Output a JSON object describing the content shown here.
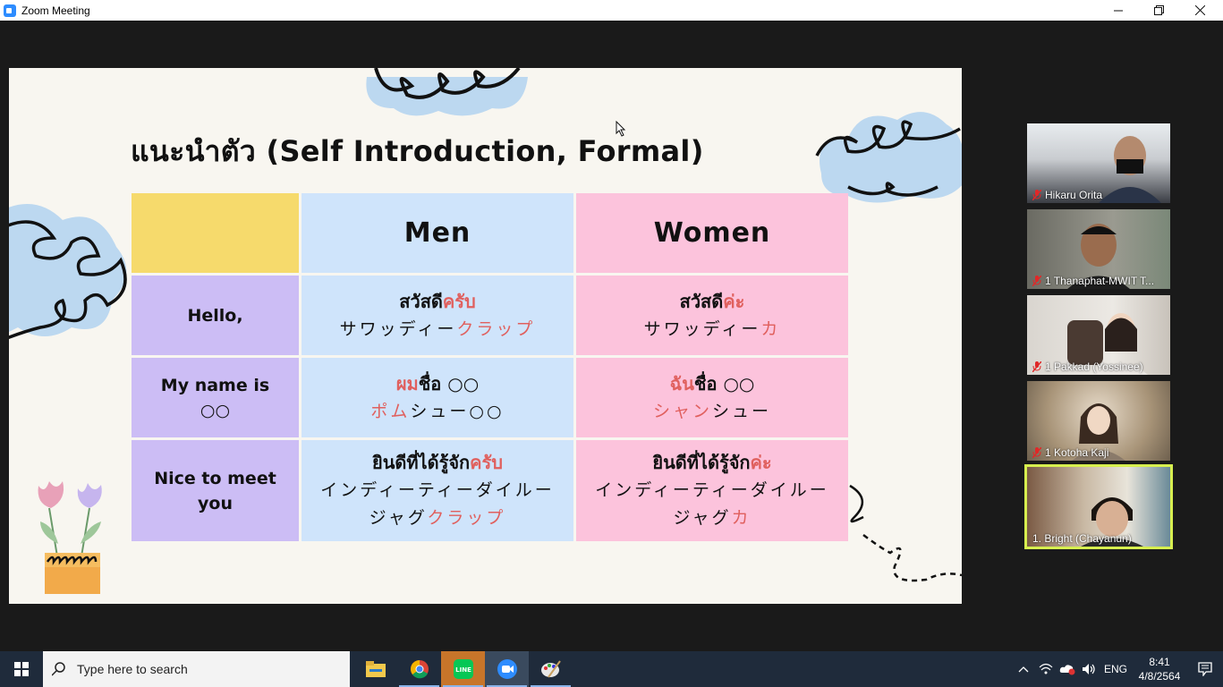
{
  "window": {
    "title": "Zoom Meeting",
    "minimize_icon": "minimize-icon",
    "restore_icon": "restore-icon",
    "close_icon": "close-icon"
  },
  "slide": {
    "title": "แนะนำตัว (Self Introduction, Formal)",
    "header": {
      "corner": "",
      "men": "Men",
      "women": "Women"
    },
    "rows": [
      {
        "label": "Hello,",
        "men_thai_a": "สวัสดี",
        "men_thai_b": "ครับ",
        "men_jp_a": "サワッディー",
        "men_jp_b": "クラップ",
        "women_thai_a": "สวัสดี",
        "women_thai_b": "ค่ะ",
        "women_jp_a": "サワッディー",
        "women_jp_b": "カ"
      },
      {
        "label_a": "My name is",
        "label_b": "○○",
        "men_thai_a": "ผม",
        "men_thai_b": "ชื่อ ○○",
        "men_jp_a": "ポム",
        "men_jp_b": "シュー○○",
        "women_thai_a": "ฉัน",
        "women_thai_b": "ชื่อ ○○",
        "women_jp_a": "シャン",
        "women_jp_b": "シュー"
      },
      {
        "label_a": "Nice to meet",
        "label_b": "you",
        "men_thai_a": "ยินดีที่ได้รู้จัก",
        "men_thai_b": "ครับ",
        "men_jp_a": "インディーティーダイルー",
        "men_jp_b": "ジャグ",
        "men_jp_c": "クラップ",
        "women_thai_a": "ยินดีที่ได้รู้จัก",
        "women_thai_b": "ค่ะ",
        "women_jp_a": "インディーティーダイルー",
        "women_jp_b": "ジャグ",
        "women_jp_c": "カ"
      }
    ],
    "colors": {
      "yellow": "#f6da6c",
      "purple": "#ccbdf5",
      "blue": "#cfe4fb",
      "pink": "#fcc3dc",
      "accent_red": "#e0605e"
    }
  },
  "participants": [
    {
      "name": "Hikaru Orita",
      "muted": true,
      "active": false
    },
    {
      "name": "1 Thanaphat-MWIT T...",
      "muted": true,
      "active": false
    },
    {
      "name": "1 Pakkad (Yossinee)",
      "muted": true,
      "active": false
    },
    {
      "name": "1 Kotoha  Kaji",
      "muted": true,
      "active": false
    },
    {
      "name": "1. Bright (Chayanun)",
      "muted": false,
      "active": true
    }
  ],
  "taskbar": {
    "search_placeholder": "Type here to search",
    "apps": [
      "file-explorer-icon",
      "chrome-icon",
      "line-icon",
      "zoom-icon",
      "paint-icon"
    ],
    "language": "ENG",
    "time": "8:41",
    "date": "4/8/2564"
  }
}
